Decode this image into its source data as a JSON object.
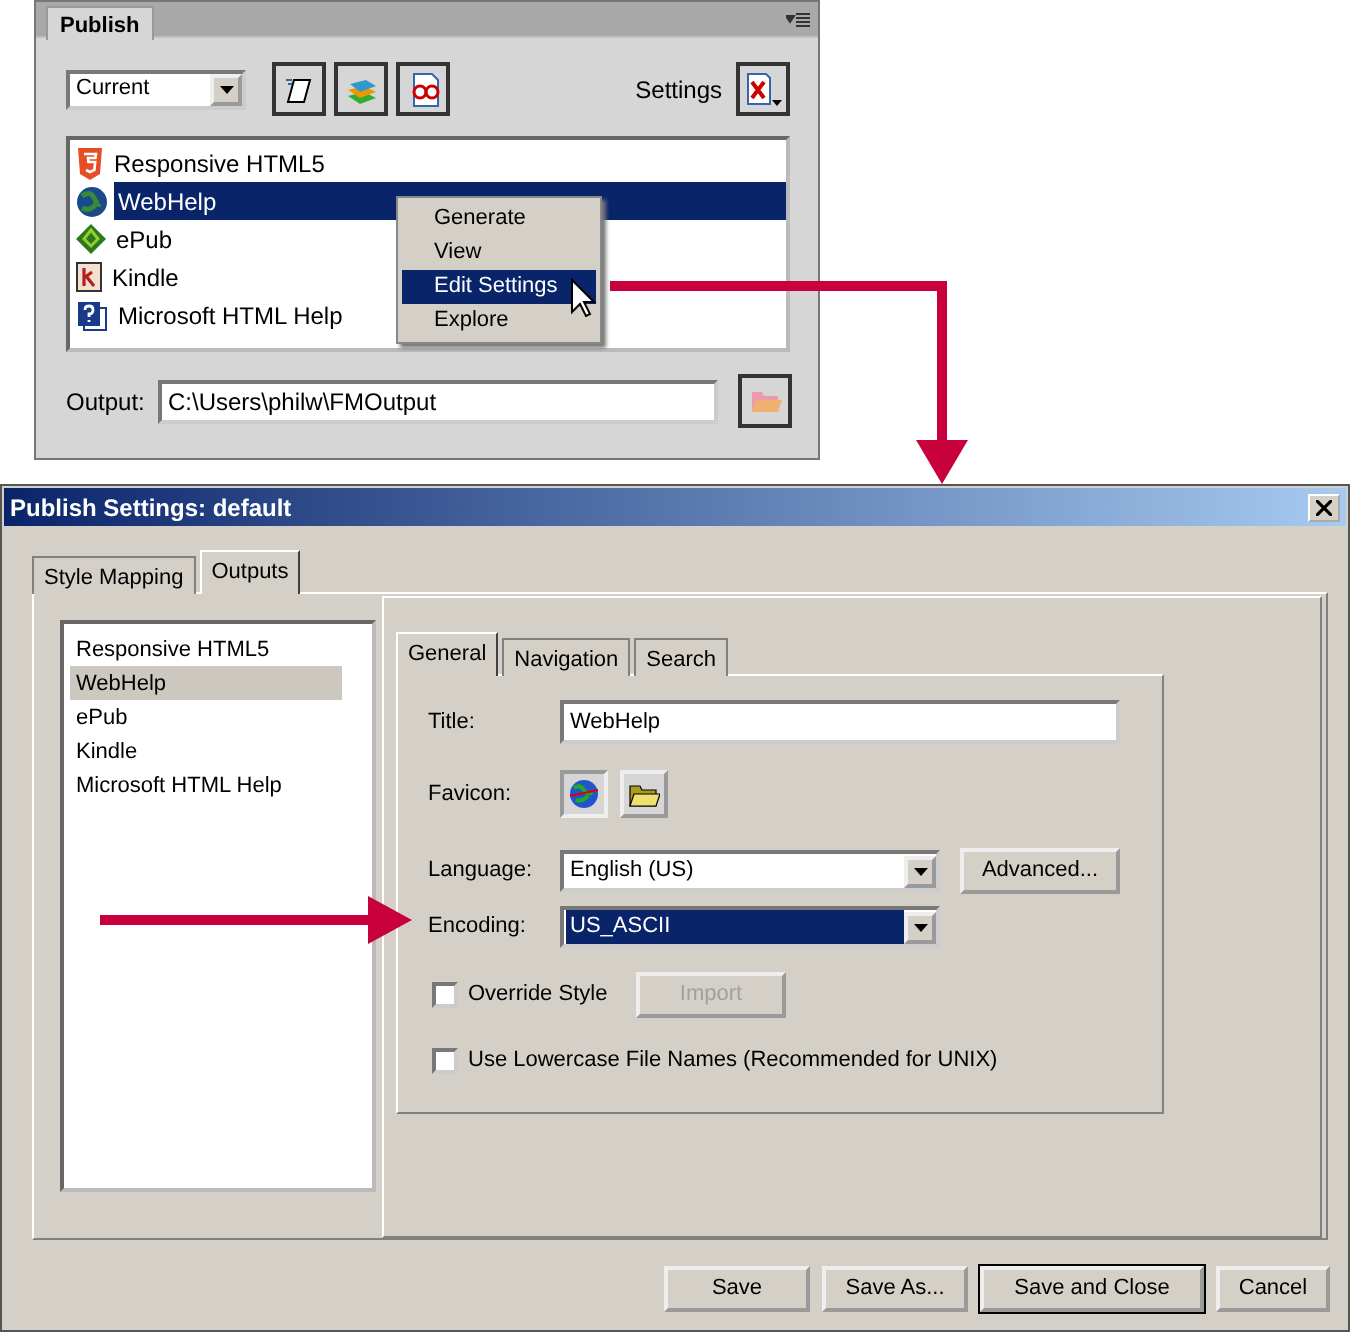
{
  "publish_panel": {
    "tab": "Publish",
    "preset": "Current",
    "settings_label": "Settings",
    "outputs": [
      {
        "label": "Responsive HTML5",
        "kind": "html5",
        "selected": false
      },
      {
        "label": "WebHelp",
        "kind": "webhelp",
        "selected": true
      },
      {
        "label": "ePub",
        "kind": "epub",
        "selected": false
      },
      {
        "label": "Kindle",
        "kind": "kindle",
        "selected": false
      },
      {
        "label": "Microsoft HTML Help",
        "kind": "chm",
        "selected": false
      }
    ],
    "context_menu": [
      {
        "label": "Generate",
        "selected": false
      },
      {
        "label": "View",
        "selected": false
      },
      {
        "label": "Edit Settings",
        "selected": true
      },
      {
        "label": "Explore",
        "selected": false
      }
    ],
    "output_label": "Output:",
    "output_path": "C:\\Users\\philw\\FMOutput"
  },
  "dialog": {
    "title": "Publish Settings: default",
    "tabs": [
      {
        "label": "Style Mapping",
        "selected": false
      },
      {
        "label": "Outputs",
        "selected": true
      }
    ],
    "outputs": [
      {
        "label": "Responsive HTML5",
        "selected": false
      },
      {
        "label": "WebHelp",
        "selected": true
      },
      {
        "label": "ePub",
        "selected": false
      },
      {
        "label": "Kindle",
        "selected": false
      },
      {
        "label": "Microsoft HTML Help",
        "selected": false
      }
    ],
    "subtabs": [
      {
        "label": "General",
        "selected": true
      },
      {
        "label": "Navigation",
        "selected": false
      },
      {
        "label": "Search",
        "selected": false
      }
    ],
    "title_label": "Title:",
    "title_value": "WebHelp",
    "favicon_label": "Favicon:",
    "language_label": "Language:",
    "language": "English (US)",
    "advanced": "Advanced...",
    "encoding_label": "Encoding:",
    "encoding": "US_ASCII",
    "encoding_highlighted": true,
    "override": {
      "label": "Override Style",
      "checked": false
    },
    "import": {
      "label": "Import",
      "disabled": true
    },
    "lowercase": {
      "label": "Use Lowercase File Names (Recommended for UNIX)",
      "checked": false
    },
    "buttons": [
      {
        "label": "Save",
        "default": false
      },
      {
        "label": "Save As...",
        "default": false
      },
      {
        "label": "Save and Close",
        "default": true
      },
      {
        "label": "Cancel",
        "default": false
      }
    ]
  }
}
